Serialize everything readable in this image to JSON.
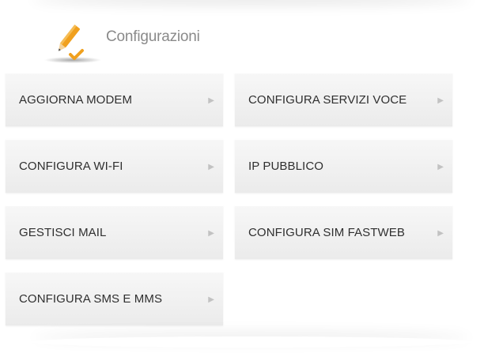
{
  "header": {
    "title": "Configurazioni",
    "icon": "pencil-check-icon",
    "icon_color": "#f0a01e"
  },
  "menu": {
    "items": [
      {
        "label": "AGGIORNA MODEM",
        "arrow": "▶"
      },
      {
        "label": "CONFIGURA SERVIZI VOCE",
        "arrow": "▶"
      },
      {
        "label": "CONFIGURA WI-FI",
        "arrow": "▶"
      },
      {
        "label": "IP PUBBLICO",
        "arrow": "▶"
      },
      {
        "label": "GESTISCI MAIL",
        "arrow": "▶"
      },
      {
        "label": "CONFIGURA SIM FASTWEB",
        "arrow": "▶"
      },
      {
        "label": "CONFIGURA SMS E MMS",
        "arrow": "▶"
      }
    ]
  }
}
